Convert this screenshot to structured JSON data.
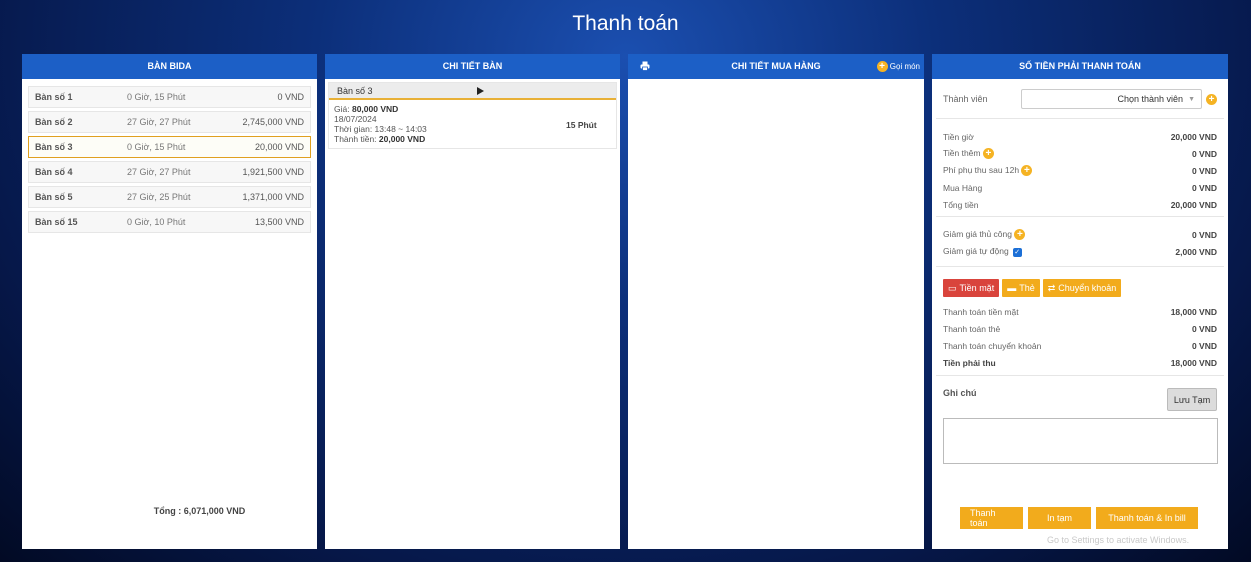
{
  "page_title": "Thanh toán",
  "panel_tables": {
    "header": "BÀN BIDA",
    "rows": [
      {
        "name": "Bàn số 1",
        "time": "0 Giờ, 15 Phút",
        "amount": "0 VND",
        "active": false
      },
      {
        "name": "Bàn số 2",
        "time": "27 Giờ, 27 Phút",
        "amount": "2,745,000 VND",
        "active": false
      },
      {
        "name": "Bàn số 3",
        "time": "0 Giờ, 15 Phút",
        "amount": "20,000 VND",
        "active": true
      },
      {
        "name": "Bàn số 4",
        "time": "27 Giờ, 27 Phút",
        "amount": "1,921,500 VND",
        "active": false
      },
      {
        "name": "Bàn số 5",
        "time": "27 Giờ, 25 Phút",
        "amount": "1,371,000 VND",
        "active": false
      },
      {
        "name": "Bàn số 15",
        "time": "0 Giờ, 10 Phút",
        "amount": "13,500 VND",
        "active": false
      }
    ],
    "total": "Tổng : 6,071,000 VND"
  },
  "panel_detail": {
    "header": "CHI TIẾT BÀN",
    "table_name": "Bàn số 3",
    "price_label": "Giá:",
    "price_value": "80,000 VND",
    "date": "18/07/2024",
    "time_range": "Thời gian: 13:48 ~ 14:03",
    "subtotal_label": "Thành tiền:",
    "subtotal_value": "20,000 VND",
    "minutes": "15 Phút"
  },
  "panel_purchase": {
    "header": "CHI TIẾT MUA HÀNG",
    "order_label": "Gọi món"
  },
  "panel_payment": {
    "header": "SỐ TIỀN PHẢI THANH TOÁN",
    "member_label": "Thành viên",
    "member_select": "Chọn thành viên",
    "hour_fee_label": "Tiền giờ",
    "hour_fee": "20,000 VND",
    "extra_label": "Tiền thêm",
    "extra": "0 VND",
    "surcharge_label": "Phí phụ thu sau 12h",
    "surcharge": "0 VND",
    "purchase_label": "Mua Hàng",
    "purchase": "0 VND",
    "total_label": "Tổng tiền",
    "total": "20,000 VND",
    "manual_discount_label": "Giảm giá thủ công",
    "manual_discount": "0 VND",
    "auto_discount_label": "Giảm giá tự động",
    "auto_discount": "2,000 VND",
    "btn_cash": "Tiền mặt",
    "btn_card": "Thẻ",
    "btn_transfer": "Chuyển khoản",
    "cash_pay_label": "Thanh toán tiền mặt",
    "cash_pay": "18,000 VND",
    "card_pay_label": "Thanh toán thẻ",
    "card_pay": "0 VND",
    "transfer_pay_label": "Thanh toán chuyển khoản",
    "transfer_pay": "0 VND",
    "due_label": "Tiền phải thu",
    "due": "18,000 VND",
    "note_label": "Ghi chú",
    "save_btn": "Lưu Tạm",
    "btn_pay": "Thanh toán",
    "btn_print_temp": "In tạm",
    "btn_pay_print": "Thanh toán & In bill",
    "watermark": "Go to Settings to activate Windows."
  },
  "colors": {
    "header_blue": "#1c5fc6",
    "accent_orange": "#f2ab1c",
    "cash_red": "#d9443c",
    "active_border": "#e0a020"
  }
}
